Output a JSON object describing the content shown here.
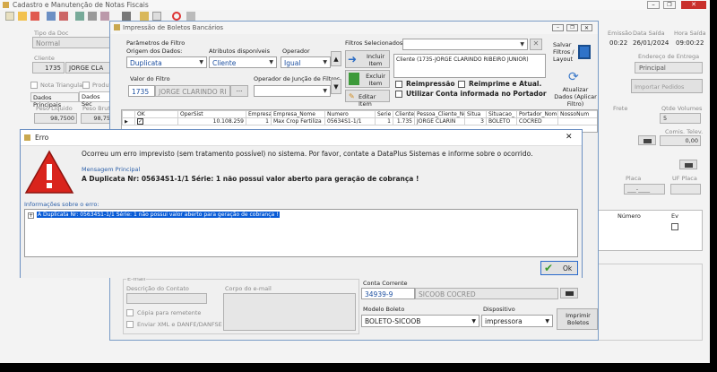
{
  "main": {
    "title": "Cadastro e Manutenção de Notas Fiscais",
    "tipo_doc_label": "Tipo da Doc",
    "tipo_doc_value": "Normal",
    "cliente_label": "Cliente",
    "cliente_code": "1735",
    "cliente_name": "JORGE CLA",
    "nota_triangular": "Nota Triangular",
    "produto": "Produt",
    "tab_dados_principais": "Dados Principais",
    "tab_dados_sec": "Dados Sec",
    "peso_liquido_label": "Peso Líquido",
    "peso_liquido_value": "98,7500",
    "peso_bruto_label": "Peso Bruto",
    "peso_bruto_value": "98,75",
    "emissao_label": "Emissão",
    "emissao_value": "00:22",
    "data_saida_label": "Data Saída",
    "data_saida_value": "26/01/2024",
    "hora_saida_label": "Hora Saída",
    "hora_saida_value": "09:00:22",
    "endereco_entrega_label": "Endereço de Entrega",
    "endereco_entrega_value": "Principal",
    "importar_pedidos": "Importar Pedidos",
    "frete_label": "Frete",
    "qtde_volumes_label": "Qtde Volumes",
    "qtde_volumes_value": "5",
    "comis_televendas_label": "Comis. Telev.",
    "comis_televendas_value": "0,00",
    "placa_label": "Placa",
    "placa_value": "___-____",
    "uf_placa_label": "UF Placa",
    "numero_header": "Número",
    "ev_header": "Ev"
  },
  "boletos": {
    "title": "Impressão de Boletos Bancários",
    "params_label": "Parâmetros de Filtro",
    "origem_label": "Origem dos Dados:",
    "origem_value": "Duplicata",
    "atributos_label": "Atributos disponíveis",
    "atributos_value": "Cliente",
    "operador_label": "Operador",
    "operador_value": "Igual",
    "valor_label": "Valor do Filtro",
    "valor_code": "1735",
    "valor_name": "JORGE CLARINDO RI",
    "juncao_label": "Operador de Junção de Filtros",
    "filtros_selecionados_label": "Filtros Selecionados",
    "filtro_item": "Cliente (1735-JORGE CLARINDO RIBEIRO JUNIOR)",
    "incluir_item": "Incluir Item",
    "excluir_item": "Excluir Item",
    "editar_item": "Editar Item",
    "reimpressao": "Reimpressão",
    "reimprime_atual": "Reimprime e Atual.",
    "utilizar_conta": "Utilizar Conta informada no Portador",
    "salvar_filtros": "Salvar Filtros / Layout",
    "atualizar_dados": "Atualizar Dados (Aplicar Filtro)",
    "grid_headers": [
      "OK",
      "OperSist",
      "Empresa",
      "Empresa_Nome",
      "Numero",
      "Serie",
      "Cliente",
      "Pessoa_Cliente_Nc",
      "Situa",
      "Situacao_",
      "Portador_Nome",
      "NossoNum"
    ],
    "grid_row": [
      "",
      "10.108.259",
      "1",
      "Max Crop Fertiliza",
      "05634S1-1/1",
      "1",
      "1.735",
      "JORGE CLARIN",
      "3",
      "BOLETO",
      "COCRED",
      ""
    ],
    "email_label": "E-mail",
    "descricao_contato_label": "Descrição do Contato",
    "corpo_email_label": "Corpo do e-mail",
    "copia_remetente": "Cópia para remetente",
    "enviar_xml": "Enviar XML e DANFE/DANFSE",
    "conta_corrente_label": "Conta Corrente",
    "conta_corrente_value": "34939-9",
    "conta_corrente_name": "SICOOB COCRED",
    "modelo_boleto_label": "Modelo Boleto",
    "modelo_boleto_value": "BOLETO-SICOOB",
    "dispositivo_label": "Dispositivo",
    "dispositivo_value": "impressora",
    "imprimir_boletos": "Imprimir Boletos"
  },
  "erro": {
    "title": "Erro",
    "message": "Ocorreu um erro imprevisto (sem tratamento possível) no sistema. Por favor, contate a DataPlus Sistemas e informe sobre o ocorrido.",
    "msg_principal_label": "Mensagem Principal",
    "msg_principal": "A Duplicata Nr: 05634S1-1/1 Série: 1 não possui valor aberto para geração de cobrança !",
    "info_label": "Informações sobre o erro:",
    "info_item": "A Duplicata Nr: 05634S1-1/1 Série: 1 não possui valor aberto para geração de cobrança !",
    "ok_label": "Ok",
    "close_glyph": "✕"
  }
}
